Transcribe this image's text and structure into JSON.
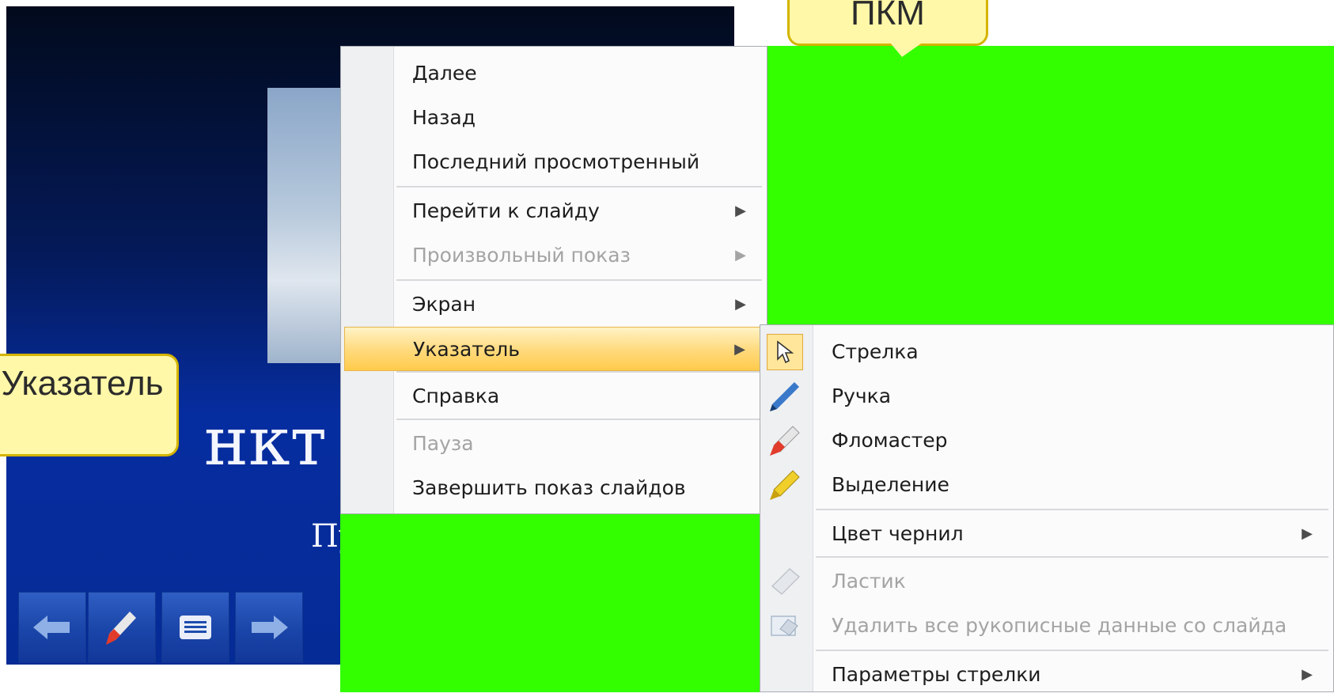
{
  "slide": {
    "title_partial": "нкт",
    "subtitle_partial": "Пу"
  },
  "callouts": {
    "top": "ПКМ",
    "left": "Указатель"
  },
  "context_menu": {
    "items": [
      {
        "label": "Далее",
        "has_submenu": false,
        "disabled": false
      },
      {
        "label": "Назад",
        "has_submenu": false,
        "disabled": false
      },
      {
        "label": "Последний просмотренный",
        "has_submenu": false,
        "disabled": false
      },
      {
        "label": "Перейти к слайду",
        "has_submenu": true,
        "disabled": false
      },
      {
        "label": "Произвольный показ",
        "has_submenu": true,
        "disabled": true
      },
      {
        "label": "Экран",
        "has_submenu": true,
        "disabled": false
      },
      {
        "label": "Указатель",
        "has_submenu": true,
        "disabled": false,
        "active": true
      },
      {
        "label": "Справка",
        "has_submenu": false,
        "disabled": false
      },
      {
        "label": "Пауза",
        "has_submenu": false,
        "disabled": true
      },
      {
        "label": "Завершить показ слайдов",
        "has_submenu": false,
        "disabled": false
      }
    ],
    "submenu_arrow": "▶"
  },
  "pointer_submenu": {
    "items": [
      {
        "label": "Стрелка",
        "icon": "arrow-cursor-icon",
        "selected": true,
        "disabled": false
      },
      {
        "label": "Ручка",
        "icon": "pen-icon",
        "disabled": false
      },
      {
        "label": "Фломастер",
        "icon": "felt-tip-icon",
        "disabled": false
      },
      {
        "label": "Выделение",
        "icon": "highlighter-icon",
        "disabled": false
      },
      {
        "label": "Цвет чернил",
        "has_submenu": true,
        "disabled": false
      },
      {
        "label": "Ластик",
        "icon": "eraser-icon",
        "disabled": true
      },
      {
        "label": "Удалить все рукописные данные со слайда",
        "icon": "clear-ink-icon",
        "disabled": true
      },
      {
        "label": "Параметры стрелки",
        "has_submenu": true,
        "disabled": false
      }
    ]
  },
  "colors": {
    "green_overlay": "#33ff00",
    "callout_fill": "#fff8a8",
    "active_item": "#ffd97a"
  }
}
